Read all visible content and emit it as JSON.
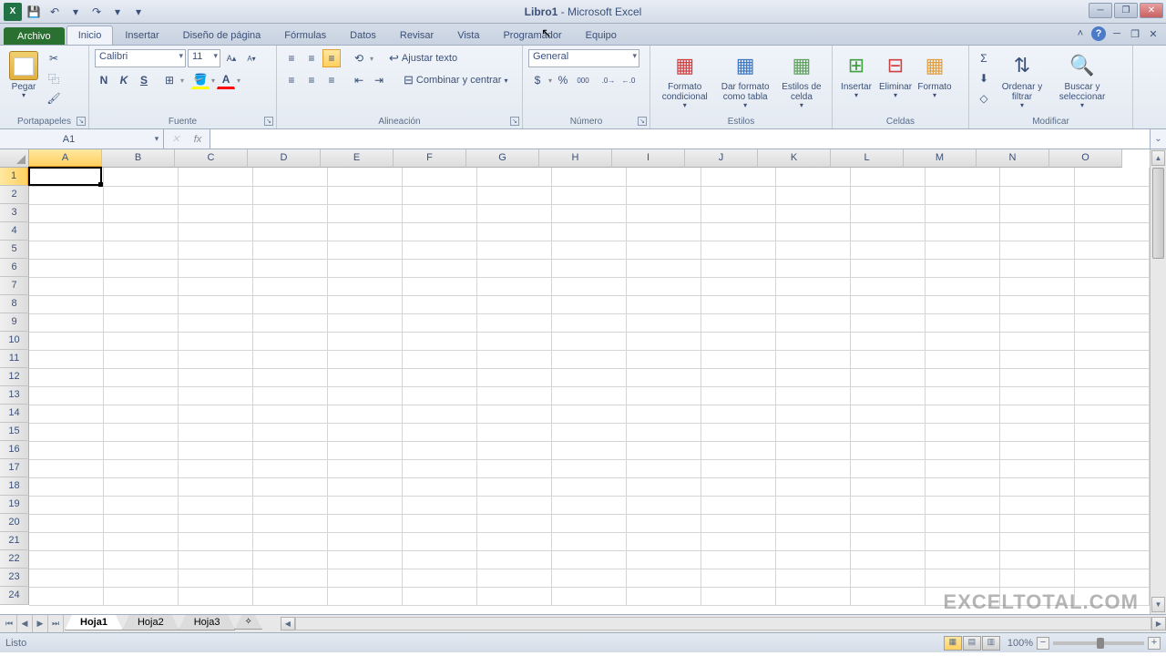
{
  "title": {
    "doc": "Libro1",
    "sep": " - ",
    "app": "Microsoft Excel"
  },
  "qat": {
    "save": "💾",
    "undo": "↶",
    "redo": "↷",
    "custom": "▾"
  },
  "tabs": {
    "file": "Archivo",
    "items": [
      "Inicio",
      "Insertar",
      "Diseño de página",
      "Fórmulas",
      "Datos",
      "Revisar",
      "Vista",
      "Programador",
      "Equipo"
    ]
  },
  "ribbon": {
    "clipboard": {
      "paste": "Pegar",
      "label": "Portapapeles",
      "cut": "✂",
      "copy": "⿻",
      "brush": "🖌"
    },
    "font": {
      "name": "Calibri",
      "size": "11",
      "grow": "A▴",
      "shrink": "A▾",
      "bold": "N",
      "italic": "K",
      "underline": "S",
      "border": "⊞",
      "fill": "🪣",
      "color": "A",
      "label": "Fuente"
    },
    "align": {
      "top": "≡",
      "mid": "≡",
      "bot": "≡",
      "orient": "⟲",
      "left": "≡",
      "center": "≡",
      "right": "≡",
      "outdent": "⇤",
      "indent": "⇥",
      "wrap_ico": "↩",
      "wrap": "Ajustar texto",
      "merge_ico": "⊟",
      "merge": "Combinar y centrar",
      "label": "Alineación"
    },
    "number": {
      "format": "General",
      "currency": "$",
      "percent": "%",
      "thousands": "000",
      "decinc": ".0→",
      "decdec": "←.0",
      "label": "Número"
    },
    "styles": {
      "cond": "Formato condicional",
      "table": "Dar formato como tabla",
      "cell": "Estilos de celda",
      "label": "Estilos"
    },
    "cells": {
      "insert": "Insertar",
      "delete": "Eliminar",
      "format": "Formato",
      "label": "Celdas"
    },
    "editing": {
      "sum": "Σ",
      "fill": "⬇",
      "clear": "◇",
      "sort": "Ordenar y filtrar",
      "find": "Buscar y seleccionar",
      "label": "Modificar"
    }
  },
  "namebox": "A1",
  "fx": "fx",
  "columns": [
    "A",
    "B",
    "C",
    "D",
    "E",
    "F",
    "G",
    "H",
    "I",
    "J",
    "K",
    "L",
    "M",
    "N",
    "O"
  ],
  "row_count": 24,
  "sheets": {
    "nav": [
      "⏮",
      "◀",
      "▶",
      "⏭"
    ],
    "tabs": [
      "Hoja1",
      "Hoja2",
      "Hoja3"
    ],
    "new": "✧"
  },
  "status": {
    "ready": "Listo",
    "zoom": "100%"
  },
  "watermark": "EXCELTOTAL.COM"
}
